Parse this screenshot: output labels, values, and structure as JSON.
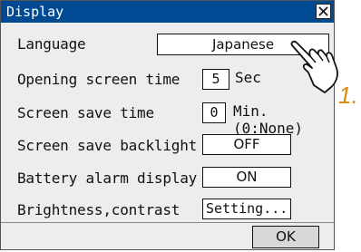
{
  "window": {
    "title": "Display"
  },
  "rows": {
    "language": {
      "label": "Language",
      "value": "Japanese"
    },
    "opening_screen_time": {
      "label": "Opening screen time",
      "value": "5",
      "unit": "Sec"
    },
    "screen_save_time": {
      "label": "Screen save time",
      "value": "0",
      "unit": "Min.(0:None)"
    },
    "screen_save_backlight": {
      "label": "Screen save backlight",
      "value": "OFF"
    },
    "battery_alarm_display": {
      "label": "Battery alarm display",
      "value": "ON"
    },
    "brightness_contrast": {
      "label": "Brightness,contrast",
      "button": "Setting..."
    }
  },
  "footer": {
    "ok_label": "OK"
  },
  "annotation": {
    "step": "1."
  },
  "colors": {
    "titlebar": "#004a93",
    "dialog_bg": "#ededed",
    "step_label": "#e08a14"
  },
  "icons": {
    "close": "close-icon",
    "pointer": "hand-pointer-icon"
  }
}
